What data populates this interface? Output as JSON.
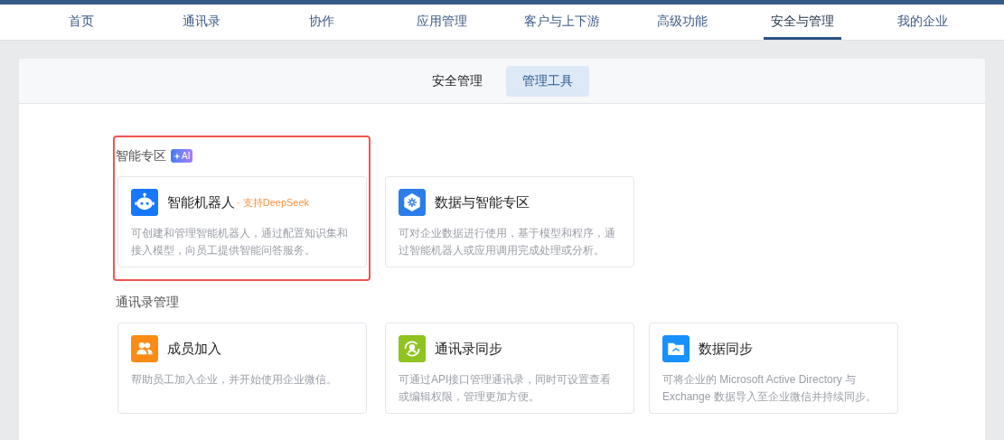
{
  "nav": [
    {
      "label": "首页",
      "selected": false
    },
    {
      "label": "通讯录",
      "selected": false
    },
    {
      "label": "协作",
      "selected": false
    },
    {
      "label": "应用管理",
      "selected": false
    },
    {
      "label": "客户与上下游",
      "selected": false
    },
    {
      "label": "高级功能",
      "selected": false
    },
    {
      "label": "安全与管理",
      "selected": true
    },
    {
      "label": "我的企业",
      "selected": false
    }
  ],
  "tabs": [
    {
      "label": "安全管理",
      "selected": false
    },
    {
      "label": "管理工具",
      "selected": true
    }
  ],
  "sections": [
    {
      "title": "智能专区",
      "badge": "AI",
      "highlighted": true,
      "cards": [
        {
          "kind": "robot",
          "color": "#1677ff",
          "title": "智能机器人",
          "tag": "· 支持DeepSeek",
          "description": "可创建和管理智能机器人，通过配置知识集和接入模型，向员工提供智能问答服务。"
        },
        {
          "kind": "data",
          "color": "#2b7de9",
          "title": "数据与智能专区",
          "description": "可对企业数据进行使用，基于模型和程序，通过智能机器人或应用调用完成处理或分析。"
        }
      ]
    },
    {
      "title": "通讯录管理",
      "highlighted": false,
      "cards": [
        {
          "kind": "members",
          "color": "#fa8c16",
          "title": "成员加入",
          "description": "帮助员工加入企业，并开始使用企业微信。"
        },
        {
          "kind": "sync",
          "color": "#8fc31f",
          "title": "通讯录同步",
          "description": "可通过API接口管理通讯录，同时可设置查看或编辑权限，管理更加方便。"
        },
        {
          "kind": "folder",
          "color": "#1890ff",
          "title": "数据同步",
          "description": "可将企业的 Microsoft Active Directory 与 Exchange 数据导入至企业微信并持续同步。"
        }
      ]
    }
  ]
}
